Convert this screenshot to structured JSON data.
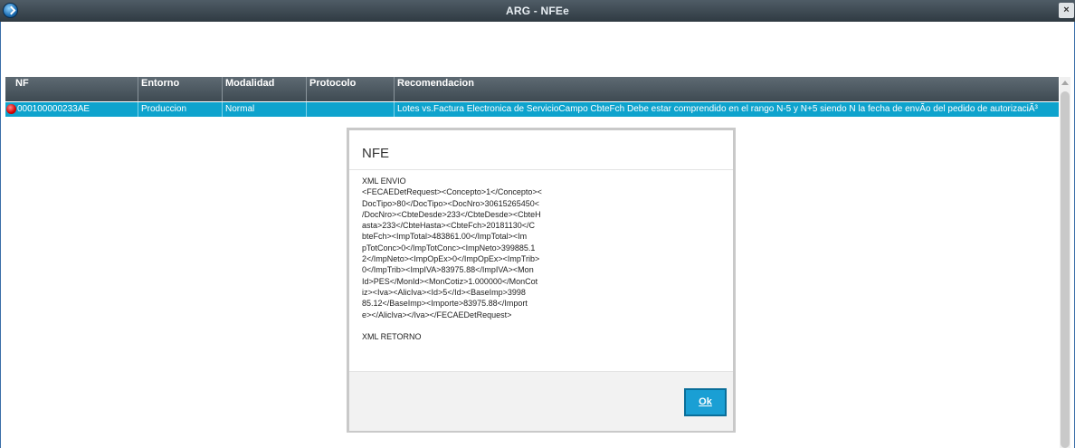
{
  "window": {
    "title": "ARG - NFEe",
    "close_label": "×"
  },
  "grid": {
    "columns": [
      "NF",
      "Entorno",
      "Modalidad",
      "Protocolo",
      "Recomendacion"
    ],
    "rows": [
      {
        "status": "error",
        "nf": "000100000233AE",
        "entorno": "Produccion",
        "modalidad": "Normal",
        "protocolo": "",
        "recomendacion": "Lotes vs.Factura Electronica de ServicioCampo CbteFch Debe estar comprendido  en el  rango  N-5 y N+5 siendo N la fecha de envÃo del pedido  de autorizaciÃ³"
      }
    ]
  },
  "modal": {
    "title": "NFE",
    "lines": [
      "XML ENVIO",
      "<FECAEDetRequest><Concepto>1</Concepto><",
      "DocTipo>80</DocTipo><DocNro>30615265450<",
      "/DocNro><CbteDesde>233</CbteDesde><CbteH",
      "asta>233</CbteHasta><CbteFch>20181130</C",
      "bteFch><ImpTotal>483861.00</ImpTotal><Im",
      "pTotConc>0</ImpTotConc><ImpNeto>399885.1",
      "2</ImpNeto><ImpOpEx>0</ImpOpEx><ImpTrib>",
      "0</ImpTrib><ImpIVA>83975.88</ImpIVA><Mon",
      "Id>PES</MonId><MonCotiz>1.000000</MonCot",
      "iz><Iva><AlicIva><Id>5</Id><BaseImp>3998",
      "85.12</BaseImp><Importe>83975.88</Import",
      "e></AlicIva></Iva></FECAEDetRequest>",
      "",
      "XML RETORNO"
    ],
    "ok_label": "Ok"
  },
  "colors": {
    "header_bg": "#4a565e",
    "selected_row": "#0ea3cd",
    "ok_button": "#1a9fd4",
    "status_error": "#d40000"
  }
}
